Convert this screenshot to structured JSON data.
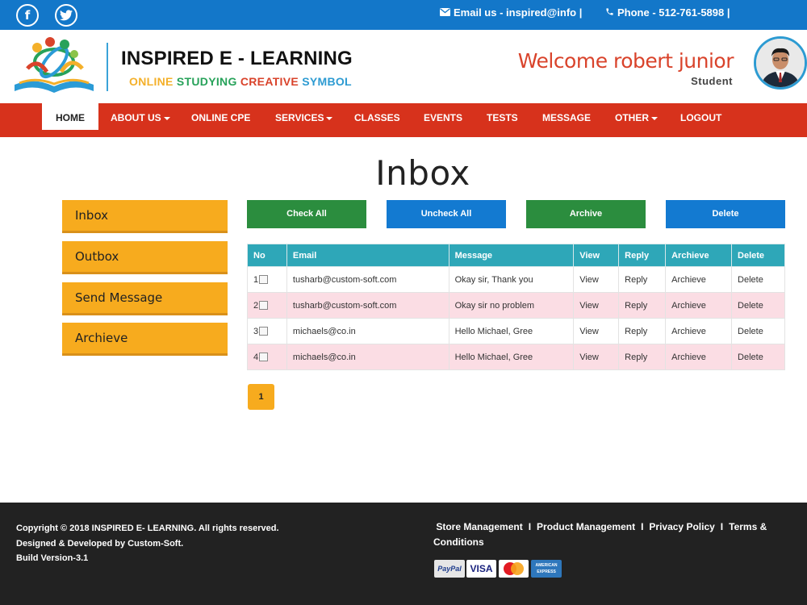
{
  "topbar": {
    "email_text": "Email us - inspired@info |",
    "phone_text": "Phone - 512-761-5898 |",
    "social": [
      "f",
      "t"
    ]
  },
  "header": {
    "brand_title": "INSPIRED E - LEARNING",
    "tagline_parts": [
      "ONLINE",
      "STUDYING",
      "CREATIVE",
      "SYMBOL"
    ],
    "welcome": "Welcome robert junior",
    "role": "Student"
  },
  "nav": {
    "items": [
      "HOME",
      "ABOUT US",
      "ONLINE CPE",
      "SERVICES",
      "CLASSES",
      "EVENTS",
      "TESTS",
      "MESSAGE",
      "OTHER",
      "LOGOUT"
    ]
  },
  "page": {
    "title": "Inbox"
  },
  "sidebar": {
    "items": [
      "Inbox",
      "Outbox",
      "Send Message",
      "Archieve"
    ]
  },
  "actions": {
    "check_all": "Check All",
    "uncheck_all": "Uncheck All",
    "archive": "Archive",
    "delete": "Delete"
  },
  "table": {
    "headers": [
      "No",
      "Email",
      "Message",
      "View",
      "Reply",
      "Archieve",
      "Delete"
    ],
    "rows": [
      {
        "no": "1",
        "email": "tusharb@custom-soft.com",
        "message": "Okay sir, Thank you",
        "view": "View",
        "reply": "Reply",
        "archieve": "Archieve",
        "delete": "Delete"
      },
      {
        "no": "2",
        "email": "tusharb@custom-soft.com",
        "message": "Okay sir no problem",
        "view": "View",
        "reply": "Reply",
        "archieve": "Archieve",
        "delete": "Delete"
      },
      {
        "no": "3",
        "email": "michaels@co.in",
        "message": "Hello Michael, Gree",
        "view": "View",
        "reply": "Reply",
        "archieve": "Archieve",
        "delete": "Delete"
      },
      {
        "no": "4",
        "email": "michaels@co.in",
        "message": "Hello Michael, Gree",
        "view": "View",
        "reply": "Reply",
        "archieve": "Archieve",
        "delete": "Delete"
      }
    ]
  },
  "pagination": {
    "current": "1"
  },
  "footer": {
    "copyright": "Copyright © 2018 INSPIRED E- LEARNING. All rights reserved.",
    "designed": "Designed & Developed by Custom-Soft.",
    "build": "Build Version-3.1",
    "links": [
      "Store Management",
      "Product Management",
      "Privacy Policy",
      "Terms & Conditions"
    ],
    "separator": "I",
    "cards": [
      "PayPal",
      "VISA",
      "MasterCard",
      "AMERICAN EXPRESS"
    ]
  },
  "colors": {
    "topbar": "#1377c9",
    "nav": "#d7321c",
    "sidebar": "#f7ab1e",
    "table_header": "#2ea7b8",
    "row_alt": "#fbdde4",
    "footer": "#222222"
  }
}
